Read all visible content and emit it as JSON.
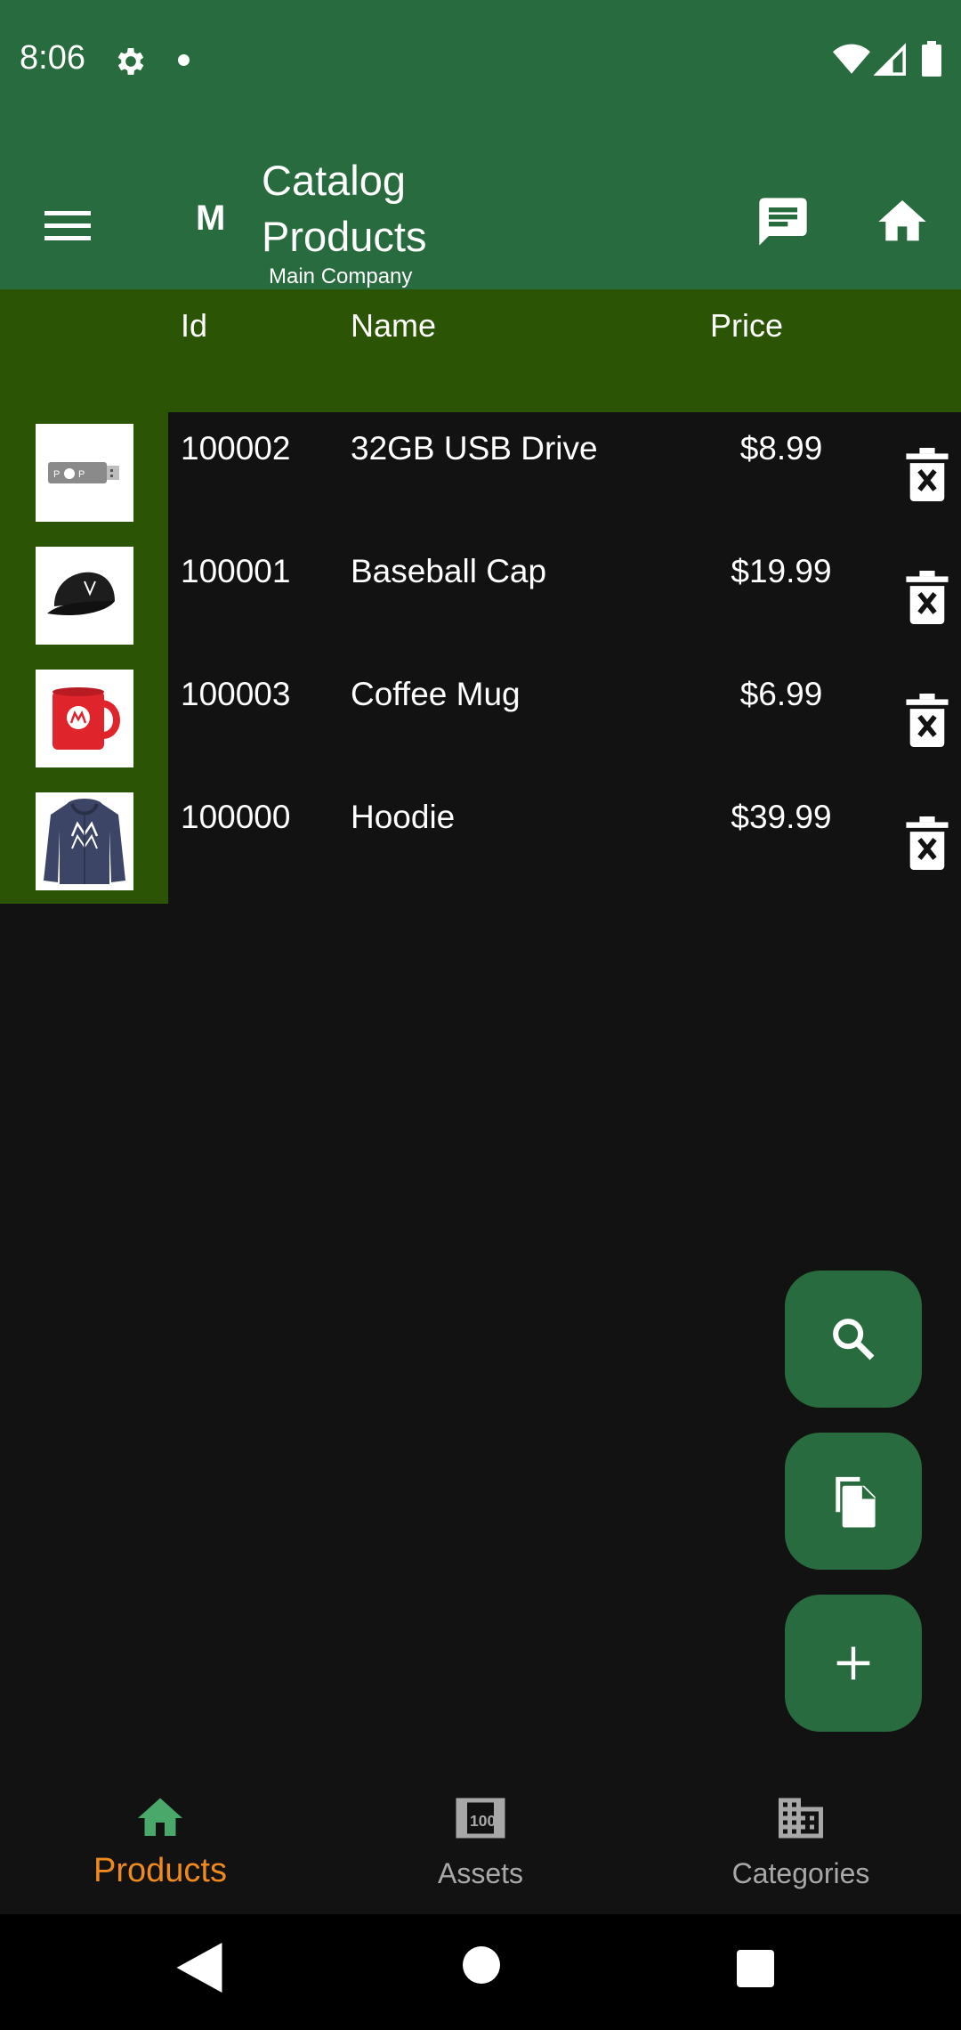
{
  "status_bar": {
    "time": "8:06"
  },
  "app_bar": {
    "avatar_letter": "M",
    "title_line1": "Catalog",
    "title_line2": "Products",
    "subtitle": "Main Company"
  },
  "table": {
    "headers": {
      "id": "Id",
      "name": "Name",
      "price": "Price"
    },
    "rows": [
      {
        "id": "100002",
        "name": "32GB USB Drive",
        "price": "$8.99",
        "image": "usb-drive"
      },
      {
        "id": "100001",
        "name": "Baseball Cap",
        "price": "$19.99",
        "image": "baseball-cap"
      },
      {
        "id": "100003",
        "name": "Coffee Mug",
        "price": "$6.99",
        "image": "coffee-mug"
      },
      {
        "id": "100000",
        "name": "Hoodie",
        "price": "$39.99",
        "image": "hoodie"
      }
    ]
  },
  "bottom_nav": {
    "items": [
      {
        "label": "Products",
        "icon": "home-icon",
        "active": true
      },
      {
        "label": "Assets",
        "icon": "assets-icon",
        "active": false
      },
      {
        "label": "Categories",
        "icon": "categories-icon",
        "active": false
      }
    ]
  },
  "colors": {
    "app_bar": "#286b3e",
    "table_header": "#2b5405",
    "background": "#121212",
    "active_nav": "#ee8a1e",
    "active_nav_icon": "#4aa86a"
  }
}
